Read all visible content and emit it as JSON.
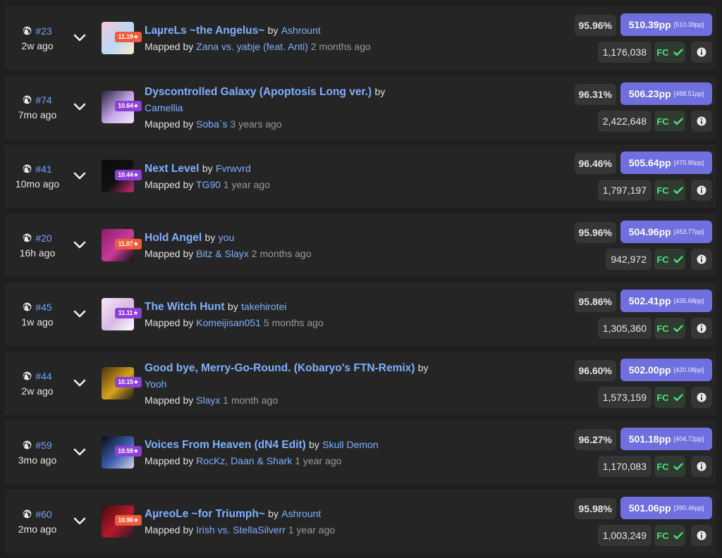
{
  "colors": {
    "star_purple": "#8e3fd8",
    "star_orange": "#f05a3a",
    "link_blue": "#7fb0ff",
    "pp_purple": "#6f6fe0",
    "fc_green": "#4ee07a"
  },
  "icons": {
    "rank": "globe-icon",
    "expand": "chevron-down-icon",
    "fc": "check-icon",
    "info": "info-icon"
  },
  "scores": [
    {
      "rank": "#23",
      "time": "2w ago",
      "stars": "11.19★",
      "star_color": "orange",
      "title": "LaµreLs ~the Angelus~",
      "by": "by",
      "artist": "Ashrount",
      "mapped_by": "Mapped by",
      "mapper": "Zana vs. yabje (feat. Anti)",
      "ago": "2 months ago",
      "acc": "95.96%",
      "pp": "510.39pp",
      "pp_raw": "[510.39pp]",
      "score": "1,176,038",
      "fc": "FC",
      "cover": [
        "#f4c7d4",
        "#b9d8f5",
        "#ffe9c6"
      ]
    },
    {
      "rank": "#74",
      "time": "7mo ago",
      "stars": "10.64★",
      "star_color": "purple",
      "title": "Dyscontrolled Galaxy (Apoptosis Long ver.)",
      "by": "by",
      "artist": "Camellia",
      "mapped_by": "Mapped by",
      "mapper": "Soba`s",
      "ago": "3 years ago",
      "acc": "96.31%",
      "pp": "506.23pp",
      "pp_raw": "[488.51pp]",
      "score": "2,422,648",
      "fc": "FC",
      "cover": [
        "#2a2240",
        "#c8a8e8",
        "#f3e6ff"
      ]
    },
    {
      "rank": "#41",
      "time": "10mo ago",
      "stars": "10.44★",
      "star_color": "purple",
      "title": "Next Level",
      "by": "by",
      "artist": "Fvrwvrd",
      "mapped_by": "Mapped by",
      "mapper": "TG90",
      "ago": "1 year ago",
      "acc": "96.46%",
      "pp": "505.64pp",
      "pp_raw": "[470.86pp]",
      "score": "1,797,197",
      "fc": "FC",
      "cover": [
        "#0c0c0c",
        "#111111",
        "#d02a7a"
      ]
    },
    {
      "rank": "#20",
      "time": "16h ago",
      "stars": "11.07★",
      "star_color": "orange",
      "title": "Hold Angel",
      "by": "by",
      "artist": "you",
      "mapped_by": "Mapped by",
      "mapper": "Bitz & Slayx",
      "ago": "2 months ago",
      "acc": "95.96%",
      "pp": "504.96pp",
      "pp_raw": "[453.77pp]",
      "score": "942,972",
      "fc": "FC",
      "cover": [
        "#8a1f6a",
        "#c93a9a",
        "#111111"
      ]
    },
    {
      "rank": "#45",
      "time": "1w ago",
      "stars": "11.11★",
      "star_color": "purple",
      "title": "The Witch Hunt",
      "by": "by",
      "artist": "takehirotei",
      "mapped_by": "Mapped by",
      "mapper": "Komeijisan051",
      "ago": "5 months ago",
      "acc": "95.86%",
      "pp": "502.41pp",
      "pp_raw": "[435.68pp]",
      "score": "1,305,360",
      "fc": "FC",
      "cover": [
        "#f7e9f7",
        "#d8b8e6",
        "#ffffff"
      ]
    },
    {
      "rank": "#44",
      "time": "2w ago",
      "stars": "10.15★",
      "star_color": "purple",
      "title": "Good bye, Merry-Go-Round. (Kobaryo's FTN-Remix)",
      "by": "by",
      "artist": "Yooh",
      "mapped_by": "Mapped by",
      "mapper": "Slayx",
      "ago": "1 month ago",
      "acc": "96.60%",
      "pp": "502.00pp",
      "pp_raw": "[420.08pp]",
      "score": "1,573,159",
      "fc": "FC",
      "cover": [
        "#4a3010",
        "#d7a21e",
        "#1a1a1a"
      ]
    },
    {
      "rank": "#59",
      "time": "3mo ago",
      "stars": "10.59★",
      "star_color": "purple",
      "title": "Voices From Heaven (dN4 Edit)",
      "by": "by",
      "artist": "Skull Demon",
      "mapped_by": "Mapped by",
      "mapper": "RocKz, Daan & Shark",
      "ago": "1 year ago",
      "acc": "96.27%",
      "pp": "501.18pp",
      "pp_raw": "[404.72pp]",
      "score": "1,170,083",
      "fc": "FC",
      "cover": [
        "#0a0a12",
        "#3c5fb0",
        "#d6d6f0"
      ]
    },
    {
      "rank": "#60",
      "time": "2mo ago",
      "stars": "10.96★",
      "star_color": "orange",
      "title": "AµreoLe ~for Triumph~",
      "by": "by",
      "artist": "Ashrount",
      "mapped_by": "Mapped by",
      "mapper": "Irish vs. StellaSilverr",
      "ago": "1 year ago",
      "acc": "95.98%",
      "pp": "501.06pp",
      "pp_raw": "[390.46pp]",
      "score": "1,003,249",
      "fc": "FC",
      "cover": [
        "#3a0c10",
        "#b8182a",
        "#202020"
      ]
    }
  ]
}
